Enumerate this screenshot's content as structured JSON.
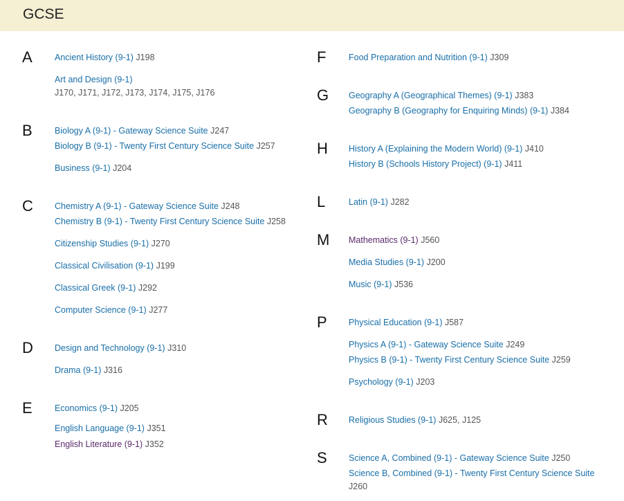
{
  "header": {
    "title": "GCSE"
  },
  "sections": {
    "A": {
      "letter": "A",
      "items": [
        {
          "name": "Ancient History (9-1)",
          "code": "J198"
        },
        {
          "name": "Art and Design (9-1)",
          "code": "J170, J171, J172, J173, J174, J175, J176"
        }
      ]
    },
    "B": {
      "letter": "B",
      "items": [
        {
          "name": "Biology A (9-1) - Gateway Science Suite",
          "code": "J247"
        },
        {
          "name": "Biology B (9-1) - Twenty First Century Science Suite",
          "code": "J257"
        },
        {
          "name": "Business (9-1)",
          "code": "J204"
        }
      ]
    },
    "C": {
      "letter": "C",
      "items": [
        {
          "name": "Chemistry A (9-1) - Gateway Science Suite",
          "code": "J248"
        },
        {
          "name": "Chemistry B (9-1) - Twenty First Century Science Suite",
          "code": "J258"
        },
        {
          "name": "Citizenship Studies (9-1)",
          "code": "J270"
        },
        {
          "name": "Classical Civilisation (9-1)",
          "code": "J199"
        },
        {
          "name": "Classical Greek (9-1)",
          "code": "J292"
        },
        {
          "name": "Computer Science (9-1)",
          "code": "J277"
        }
      ]
    },
    "D": {
      "letter": "D",
      "items": [
        {
          "name": "Design and Technology (9-1)",
          "code": "J310"
        },
        {
          "name": "Drama (9-1)",
          "code": "J316"
        }
      ]
    },
    "E": {
      "letter": "E",
      "items": [
        {
          "name": "Economics (9-1)",
          "code": "J205"
        },
        {
          "name": "English Language (9-1)",
          "code": "J351"
        },
        {
          "name": "English Literature (9-1)",
          "code": "J352"
        }
      ]
    },
    "F": {
      "letter": "F",
      "items": [
        {
          "name": "Food Preparation and Nutrition (9-1)",
          "code": "J309"
        }
      ]
    },
    "G": {
      "letter": "G",
      "items": [
        {
          "name": "Geography A (Geographical Themes) (9-1)",
          "code": "J383"
        },
        {
          "name": "Geography B (Geography for Enquiring Minds) (9-1)",
          "code": "J384"
        }
      ]
    },
    "H": {
      "letter": "H",
      "items": [
        {
          "name": "History A (Explaining the Modern World) (9-1)",
          "code": "J410"
        },
        {
          "name": "History B (Schools History Project) (9-1)",
          "code": "J411"
        }
      ]
    },
    "L": {
      "letter": "L",
      "items": [
        {
          "name": "Latin (9-1)",
          "code": "J282"
        }
      ]
    },
    "M": {
      "letter": "M",
      "items": [
        {
          "name": "Mathematics (9-1)",
          "code": "J560"
        },
        {
          "name": "Media Studies (9-1)",
          "code": "J200"
        },
        {
          "name": "Music (9-1)",
          "code": "J536"
        }
      ]
    },
    "P": {
      "letter": "P",
      "items": [
        {
          "name": "Physical Education (9-1)",
          "code": "J587"
        },
        {
          "name": "Physics A (9-1) - Gateway Science Suite",
          "code": "J249"
        },
        {
          "name": "Physics B (9-1) - Twenty First Century Science Suite",
          "code": "J259"
        },
        {
          "name": "Psychology (9-1)",
          "code": "J203"
        }
      ]
    },
    "R": {
      "letter": "R",
      "items": [
        {
          "name": "Religious Studies (9-1)",
          "code": "J625, J125"
        }
      ]
    },
    "S": {
      "letter": "S",
      "items": [
        {
          "name": "Science A, Combined (9-1) - Gateway Science Suite",
          "code": "J250"
        },
        {
          "name": "Science B, Combined (9-1) - Twenty First Century Science Suite",
          "code": "J260"
        }
      ]
    }
  },
  "colors": {
    "header_bg": "#f5efd4",
    "link": "#1a6fa8",
    "visited_link": "#5a2a6a",
    "code_text": "#555555"
  }
}
